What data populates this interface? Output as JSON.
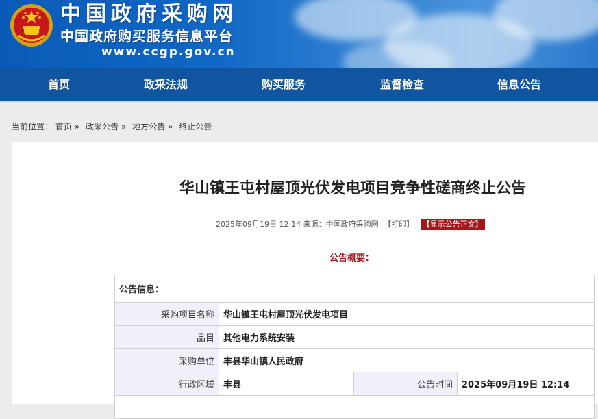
{
  "header": {
    "site_title": "中国政府采购网",
    "site_subtitle": "中国政府购买服务信息平台",
    "site_url": "www.ccgp.gov.cn"
  },
  "nav": {
    "items": [
      "首页",
      "政采法规",
      "购买服务",
      "监督检查",
      "信息公告"
    ]
  },
  "breadcrumb": {
    "prefix": "当前位置：",
    "items": [
      "首页",
      "政采公告",
      "地方公告",
      "终止公告"
    ],
    "separator": "»"
  },
  "notice": {
    "title": "华山镇王屯村屋顶光伏发电项目竞争性磋商终止公告",
    "meta_text": "2025年09月19日 12:14 来源：中国政府采购网",
    "print_label": "【打印】",
    "toggle_label": "【显示公告正文】",
    "summary_heading": "公告概要："
  },
  "info": {
    "section_title": "公告信息：",
    "rows": [
      {
        "label": "采购项目名称",
        "value": "华山镇王屯村屋顶光伏发电项目"
      },
      {
        "label": "品目",
        "value": "其他电力系统安装"
      },
      {
        "label": "采购单位",
        "value": "丰县华山镇人民政府"
      }
    ],
    "region_label": "行政区域",
    "region_value": "丰县",
    "time_label": "公告时间",
    "time_value": "2025年09月19日 12:14"
  },
  "colors": {
    "nav_bg": "#11549f",
    "accent_red": "#a8161b",
    "label_bg": "#f0f0fa"
  }
}
